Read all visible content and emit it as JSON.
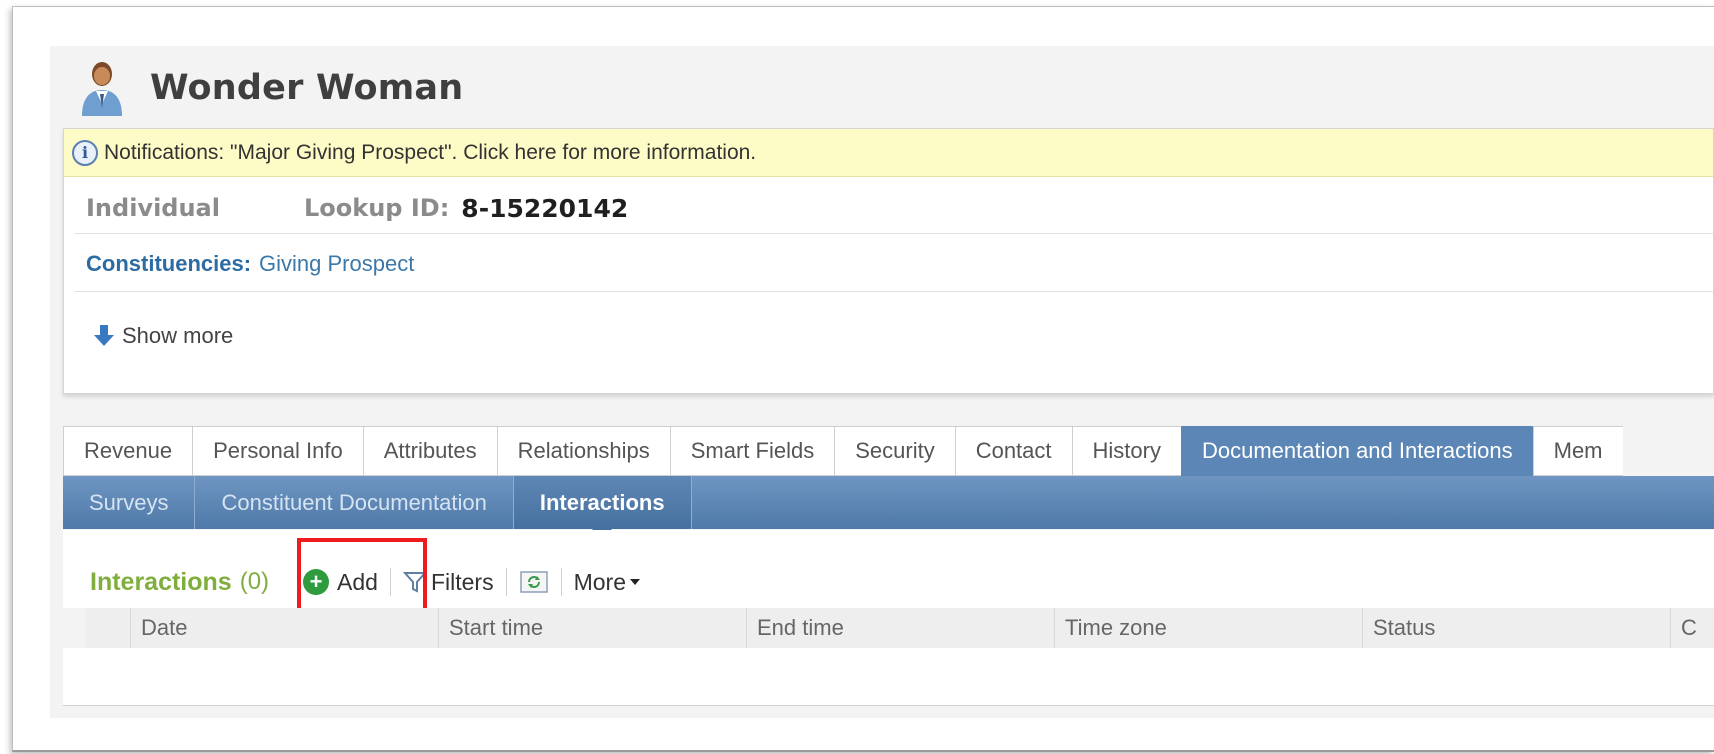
{
  "person": {
    "name": "Wonder Woman",
    "icon": "person-icon"
  },
  "notification": {
    "icon": "info-icon",
    "text": "Notifications: \"Major Giving Prospect\". Click here for more information."
  },
  "record": {
    "type": "Individual",
    "lookup_label": "Lookup ID:",
    "lookup_value": "8-15220142",
    "constituencies_label": "Constituencies:",
    "constituencies_value": "Giving Prospect"
  },
  "show_more": {
    "label": "Show more",
    "icon": "arrow-down-icon"
  },
  "tabs": [
    {
      "label": "Revenue"
    },
    {
      "label": "Personal Info"
    },
    {
      "label": "Attributes"
    },
    {
      "label": "Relationships"
    },
    {
      "label": "Smart Fields"
    },
    {
      "label": "Security"
    },
    {
      "label": "Contact"
    },
    {
      "label": "History"
    },
    {
      "label": "Documentation and Interactions",
      "active": true
    },
    {
      "label": "Mem"
    }
  ],
  "subtabs": [
    {
      "label": "Surveys"
    },
    {
      "label": "Constituent Documentation"
    },
    {
      "label": "Interactions",
      "active": true
    }
  ],
  "section": {
    "title": "Interactions",
    "count": "(0)",
    "add_label": "Add",
    "filters_label": "Filters",
    "more_label": "More"
  },
  "grid": {
    "columns": [
      "Date",
      "Start time",
      "End time",
      "Time zone",
      "Status",
      "C"
    ]
  },
  "colors": {
    "accent_tab": "#5b86b5",
    "section_green": "#7fae3c",
    "highlight_red": "#ee1c1c",
    "notif_bg": "#fdfbc6"
  }
}
